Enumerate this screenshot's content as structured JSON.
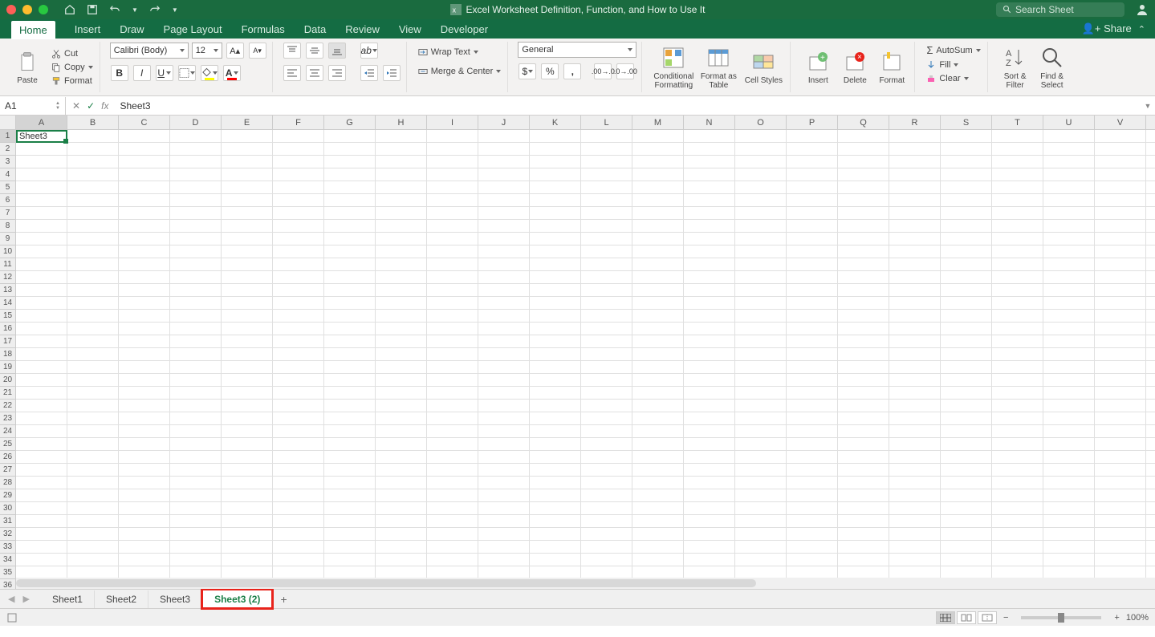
{
  "window": {
    "title": "Excel Worksheet Definition, Function, and How to Use It",
    "search_placeholder": "Search Sheet"
  },
  "tabs": {
    "items": [
      "Home",
      "Insert",
      "Draw",
      "Page Layout",
      "Formulas",
      "Data",
      "Review",
      "View",
      "Developer"
    ],
    "active": "Home",
    "share": "Share"
  },
  "ribbon": {
    "paste": "Paste",
    "cut": "Cut",
    "copy": "Copy",
    "format": "Format",
    "font_name": "Calibri (Body)",
    "font_size": "12",
    "wrap_text": "Wrap Text",
    "merge_center": "Merge & Center",
    "number_format": "General",
    "conditional_formatting": "Conditional Formatting",
    "format_as_table": "Format as Table",
    "cell_styles": "Cell Styles",
    "insert": "Insert",
    "delete": "Delete",
    "format_btn": "Format",
    "autosum": "AutoSum",
    "fill": "Fill",
    "clear": "Clear",
    "sort_filter": "Sort & Filter",
    "find_select": "Find & Select"
  },
  "formula": {
    "name_box": "A1",
    "fx_value": "Sheet3"
  },
  "grid": {
    "columns": [
      "A",
      "B",
      "C",
      "D",
      "E",
      "F",
      "G",
      "H",
      "I",
      "J",
      "K",
      "L",
      "M",
      "N",
      "O",
      "P",
      "Q",
      "R",
      "S",
      "T",
      "U",
      "V"
    ],
    "rows": 36,
    "active_cell_value": "Sheet3"
  },
  "sheets": {
    "tabs": [
      "Sheet1",
      "Sheet2",
      "Sheet3",
      "Sheet3 (2)"
    ],
    "active_index": 3
  },
  "status": {
    "zoom": "100%"
  }
}
